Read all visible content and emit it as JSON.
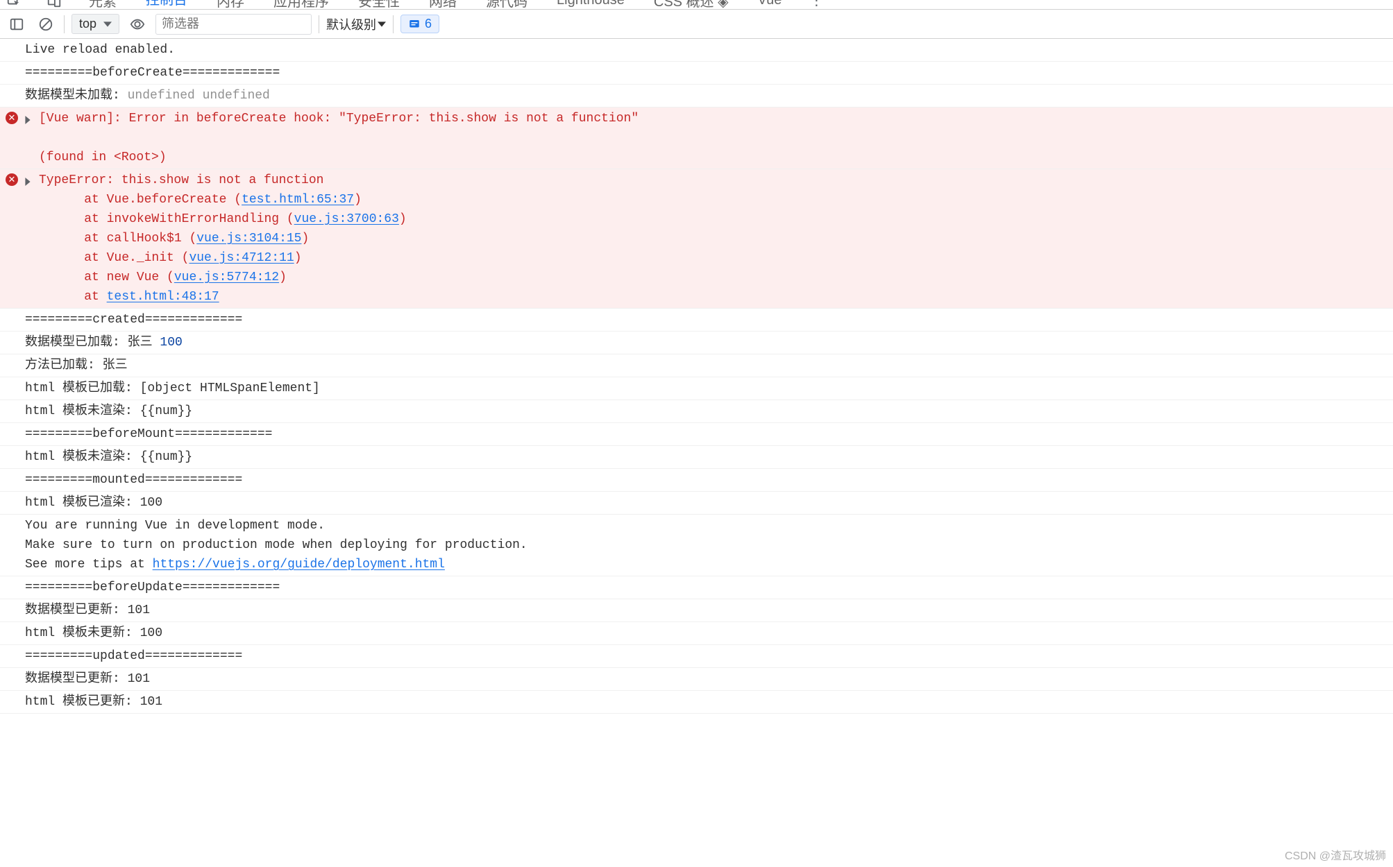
{
  "panelTabs": {
    "items": [
      {
        "label": "元素"
      },
      {
        "label": "控制台",
        "active": true
      },
      {
        "label": "内存"
      },
      {
        "label": "应用程序"
      },
      {
        "label": "安全性"
      },
      {
        "label": "网络"
      },
      {
        "label": "源代码"
      },
      {
        "label": "Lighthouse"
      },
      {
        "label": "CSS 概述"
      },
      {
        "label": "Vue"
      }
    ],
    "overflowIcon": "⋮"
  },
  "toolbar": {
    "context": "top",
    "filterPlaceholder": "筛选器",
    "levels": "默认级别",
    "issueCount": "6"
  },
  "logs": [
    {
      "type": "plain",
      "text": "Live reload enabled."
    },
    {
      "type": "plain",
      "text": "=========beforeCreate============="
    },
    {
      "type": "plain-gray",
      "prefix": "数据模型未加载: ",
      "gray": "undefined undefined"
    },
    {
      "type": "error-warn",
      "disclose": true,
      "line1": "[Vue warn]: Error in beforeCreate hook: \"TypeError: this.show is not a function\"",
      "line2": "(found in <Root>)"
    },
    {
      "type": "error-stack",
      "disclose": true,
      "head": "TypeError: this.show is not a function",
      "frames": [
        {
          "pre": "    at Vue.beforeCreate (",
          "link": "test.html:65:37",
          "post": ")"
        },
        {
          "pre": "    at invokeWithErrorHandling (",
          "link": "vue.js:3700:63",
          "post": ")"
        },
        {
          "pre": "    at callHook$1 (",
          "link": "vue.js:3104:15",
          "post": ")"
        },
        {
          "pre": "    at Vue._init (",
          "link": "vue.js:4712:11",
          "post": ")"
        },
        {
          "pre": "    at new Vue (",
          "link": "vue.js:5774:12",
          "post": ")"
        },
        {
          "pre": "    at ",
          "link": "test.html:48:17",
          "post": ""
        }
      ]
    },
    {
      "type": "plain",
      "text": "=========created============="
    },
    {
      "type": "plain-blue",
      "prefix": "数据模型已加载: 张三 ",
      "blue": "100"
    },
    {
      "type": "plain",
      "text": "方法已加载: 张三"
    },
    {
      "type": "plain",
      "text": "html 模板已加载: [object HTMLSpanElement]"
    },
    {
      "type": "plain",
      "text": "html 模板未渲染: {{num}}"
    },
    {
      "type": "plain",
      "text": "=========beforeMount============="
    },
    {
      "type": "plain",
      "text": "html 模板未渲染: {{num}}"
    },
    {
      "type": "plain",
      "text": "=========mounted============="
    },
    {
      "type": "plain",
      "text": "html 模板已渲染: 100"
    },
    {
      "type": "devmode",
      "l1": "You are running Vue in development mode.",
      "l2": "Make sure to turn on production mode when deploying for production.",
      "l3pre": "See more tips at ",
      "l3link": "https://vuejs.org/guide/deployment.html"
    },
    {
      "type": "plain",
      "text": "=========beforeUpdate============="
    },
    {
      "type": "plain",
      "text": "数据模型已更新: 101"
    },
    {
      "type": "plain",
      "text": "html 模板未更新: 100"
    },
    {
      "type": "plain",
      "text": "=========updated============="
    },
    {
      "type": "plain",
      "text": "数据模型已更新: 101"
    },
    {
      "type": "plain",
      "text": "html 模板已更新: 101"
    }
  ],
  "watermark": "CSDN @渣瓦攻城狮"
}
